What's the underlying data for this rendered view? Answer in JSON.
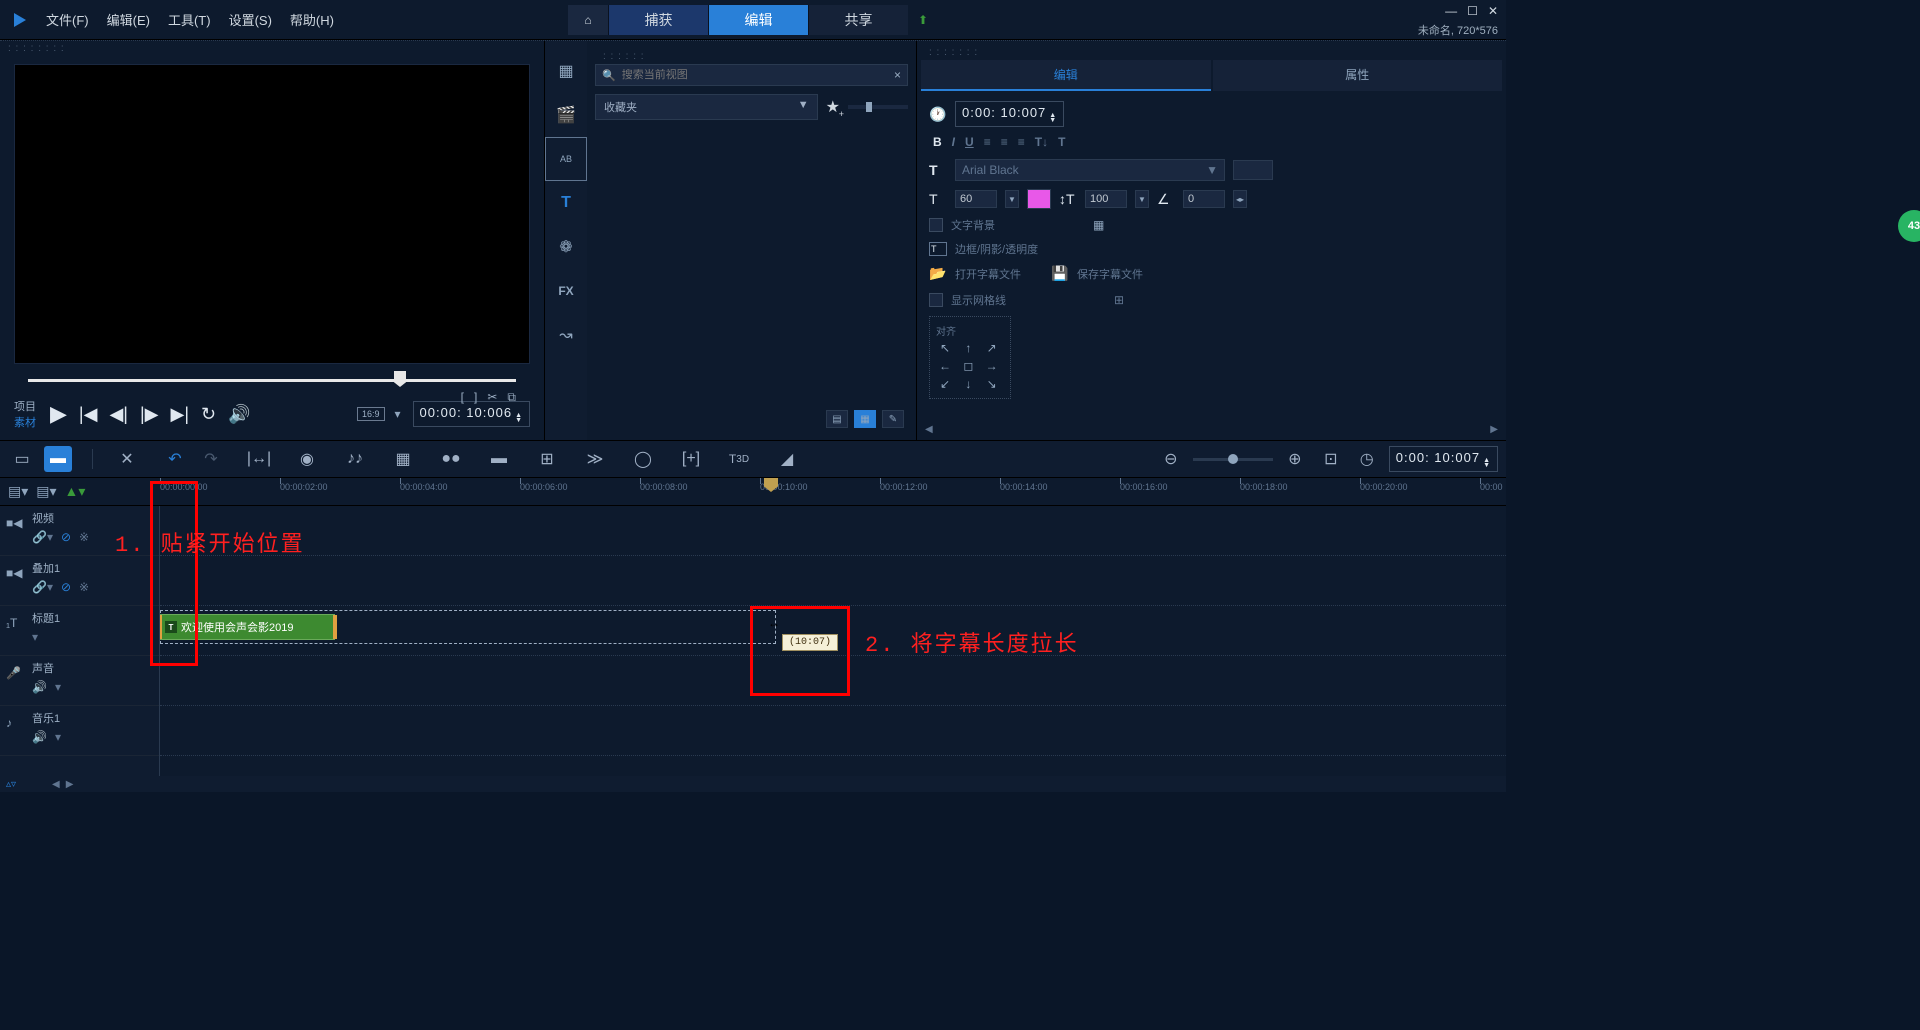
{
  "menu": {
    "file": "文件(F)",
    "edit": "编辑(E)",
    "tools": "工具(T)",
    "settings": "设置(S)",
    "help": "帮助(H)"
  },
  "workflow": {
    "capture": "捕获",
    "edit": "编辑",
    "share": "共享"
  },
  "project_info": "未命名, 720*576",
  "preview": {
    "project_label": "项目",
    "clip_label": "素材",
    "aspect": "16:9",
    "timecode": "00:00: 10:006"
  },
  "library": {
    "search_placeholder": "搜索当前视图",
    "favorites": "收藏夹"
  },
  "props": {
    "tab_edit": "编辑",
    "tab_attr": "属性",
    "duration": "0:00: 10:007",
    "font_name": "Arial Black",
    "font_size": "60",
    "line_spacing": "100",
    "rotation": "0",
    "bg_label": "文字背景",
    "border_label": "边框/阴影/透明度",
    "open_sub": "打开字幕文件",
    "save_sub": "保存字幕文件",
    "grid_label": "显示网格线",
    "align_label": "对齐"
  },
  "badge": "43",
  "timeline": {
    "ticks": [
      "00:00:00:00",
      "00:00:02:00",
      "00:00:04:00",
      "00:00:06:00",
      "00:00:08:00",
      "00:00:10:00",
      "00:00:12:00",
      "00:00:14:00",
      "00:00:16:00",
      "00:00:18:00",
      "00:00:20:00",
      "00:00"
    ],
    "duration_box": "0:00: 10:007",
    "tracks": {
      "video": "视频",
      "overlay": "叠加1",
      "title": "标题1",
      "voice": "声音",
      "music": "音乐1"
    },
    "title_clip_text": "欢迎使用会声会影2019",
    "drag_tooltip": "(10:07)"
  },
  "anno": {
    "a1": "1. 贴紧开始位置",
    "a2": "2. 将字幕长度拉长"
  }
}
